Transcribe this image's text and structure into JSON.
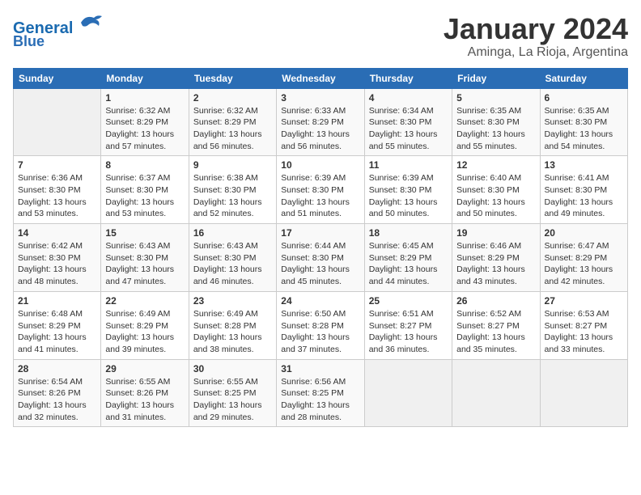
{
  "header": {
    "logo_line1": "General",
    "logo_line2": "Blue",
    "month_title": "January 2024",
    "subtitle": "Aminga, La Rioja, Argentina"
  },
  "days_of_week": [
    "Sunday",
    "Monday",
    "Tuesday",
    "Wednesday",
    "Thursday",
    "Friday",
    "Saturday"
  ],
  "weeks": [
    [
      {
        "day": "",
        "sunrise": "",
        "sunset": "",
        "daylight": ""
      },
      {
        "day": "1",
        "sunrise": "6:32 AM",
        "sunset": "8:29 PM",
        "daylight": "13 hours and 57 minutes."
      },
      {
        "day": "2",
        "sunrise": "6:32 AM",
        "sunset": "8:29 PM",
        "daylight": "13 hours and 56 minutes."
      },
      {
        "day": "3",
        "sunrise": "6:33 AM",
        "sunset": "8:29 PM",
        "daylight": "13 hours and 56 minutes."
      },
      {
        "day": "4",
        "sunrise": "6:34 AM",
        "sunset": "8:30 PM",
        "daylight": "13 hours and 55 minutes."
      },
      {
        "day": "5",
        "sunrise": "6:35 AM",
        "sunset": "8:30 PM",
        "daylight": "13 hours and 55 minutes."
      },
      {
        "day": "6",
        "sunrise": "6:35 AM",
        "sunset": "8:30 PM",
        "daylight": "13 hours and 54 minutes."
      }
    ],
    [
      {
        "day": "7",
        "sunrise": "6:36 AM",
        "sunset": "8:30 PM",
        "daylight": "13 hours and 53 minutes."
      },
      {
        "day": "8",
        "sunrise": "6:37 AM",
        "sunset": "8:30 PM",
        "daylight": "13 hours and 53 minutes."
      },
      {
        "day": "9",
        "sunrise": "6:38 AM",
        "sunset": "8:30 PM",
        "daylight": "13 hours and 52 minutes."
      },
      {
        "day": "10",
        "sunrise": "6:39 AM",
        "sunset": "8:30 PM",
        "daylight": "13 hours and 51 minutes."
      },
      {
        "day": "11",
        "sunrise": "6:39 AM",
        "sunset": "8:30 PM",
        "daylight": "13 hours and 50 minutes."
      },
      {
        "day": "12",
        "sunrise": "6:40 AM",
        "sunset": "8:30 PM",
        "daylight": "13 hours and 50 minutes."
      },
      {
        "day": "13",
        "sunrise": "6:41 AM",
        "sunset": "8:30 PM",
        "daylight": "13 hours and 49 minutes."
      }
    ],
    [
      {
        "day": "14",
        "sunrise": "6:42 AM",
        "sunset": "8:30 PM",
        "daylight": "13 hours and 48 minutes."
      },
      {
        "day": "15",
        "sunrise": "6:43 AM",
        "sunset": "8:30 PM",
        "daylight": "13 hours and 47 minutes."
      },
      {
        "day": "16",
        "sunrise": "6:43 AM",
        "sunset": "8:30 PM",
        "daylight": "13 hours and 46 minutes."
      },
      {
        "day": "17",
        "sunrise": "6:44 AM",
        "sunset": "8:30 PM",
        "daylight": "13 hours and 45 minutes."
      },
      {
        "day": "18",
        "sunrise": "6:45 AM",
        "sunset": "8:29 PM",
        "daylight": "13 hours and 44 minutes."
      },
      {
        "day": "19",
        "sunrise": "6:46 AM",
        "sunset": "8:29 PM",
        "daylight": "13 hours and 43 minutes."
      },
      {
        "day": "20",
        "sunrise": "6:47 AM",
        "sunset": "8:29 PM",
        "daylight": "13 hours and 42 minutes."
      }
    ],
    [
      {
        "day": "21",
        "sunrise": "6:48 AM",
        "sunset": "8:29 PM",
        "daylight": "13 hours and 41 minutes."
      },
      {
        "day": "22",
        "sunrise": "6:49 AM",
        "sunset": "8:29 PM",
        "daylight": "13 hours and 39 minutes."
      },
      {
        "day": "23",
        "sunrise": "6:49 AM",
        "sunset": "8:28 PM",
        "daylight": "13 hours and 38 minutes."
      },
      {
        "day": "24",
        "sunrise": "6:50 AM",
        "sunset": "8:28 PM",
        "daylight": "13 hours and 37 minutes."
      },
      {
        "day": "25",
        "sunrise": "6:51 AM",
        "sunset": "8:27 PM",
        "daylight": "13 hours and 36 minutes."
      },
      {
        "day": "26",
        "sunrise": "6:52 AM",
        "sunset": "8:27 PM",
        "daylight": "13 hours and 35 minutes."
      },
      {
        "day": "27",
        "sunrise": "6:53 AM",
        "sunset": "8:27 PM",
        "daylight": "13 hours and 33 minutes."
      }
    ],
    [
      {
        "day": "28",
        "sunrise": "6:54 AM",
        "sunset": "8:26 PM",
        "daylight": "13 hours and 32 minutes."
      },
      {
        "day": "29",
        "sunrise": "6:55 AM",
        "sunset": "8:26 PM",
        "daylight": "13 hours and 31 minutes."
      },
      {
        "day": "30",
        "sunrise": "6:55 AM",
        "sunset": "8:25 PM",
        "daylight": "13 hours and 29 minutes."
      },
      {
        "day": "31",
        "sunrise": "6:56 AM",
        "sunset": "8:25 PM",
        "daylight": "13 hours and 28 minutes."
      },
      {
        "day": "",
        "sunrise": "",
        "sunset": "",
        "daylight": ""
      },
      {
        "day": "",
        "sunrise": "",
        "sunset": "",
        "daylight": ""
      },
      {
        "day": "",
        "sunrise": "",
        "sunset": "",
        "daylight": ""
      }
    ]
  ]
}
